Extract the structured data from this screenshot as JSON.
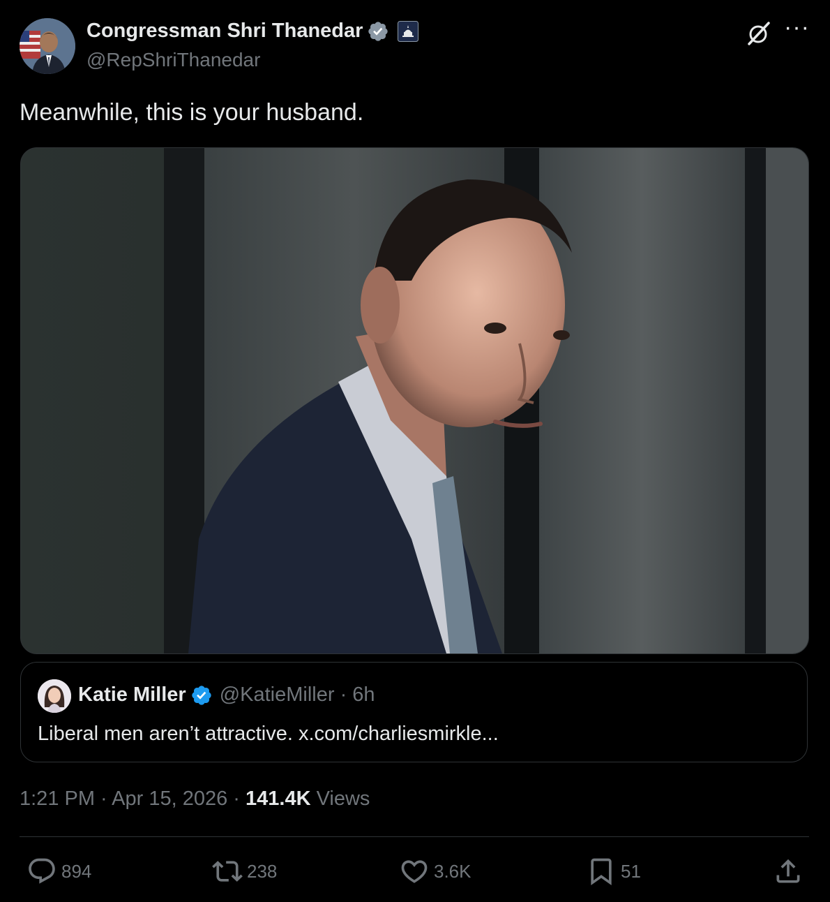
{
  "author": {
    "display_name": "Congressman Shri Thanedar",
    "handle": "@RepShriThanedar",
    "verified_icon": "verified-badge-icon",
    "affiliation_icon": "capitol-badge-icon"
  },
  "tweet": {
    "text": "Meanwhile, this is your husband."
  },
  "quote": {
    "display_name": "Katie Miller",
    "handle_time": "@KatieMiller · 6h",
    "text": "Liberal men aren’t attractive. x.com/charliesmirkle..."
  },
  "meta": {
    "time_date": "1:21 PM · Apr 15, 2026 · ",
    "views_count": "141.4K",
    "views_label": " Views"
  },
  "actions": {
    "replies": "894",
    "reposts": "238",
    "likes": "3.6K",
    "bookmarks": "51"
  },
  "colors": {
    "background": "#000000",
    "text": "#e7e9ea",
    "muted": "#71767b",
    "verified": "#1d9bf0",
    "border": "#2f3336"
  }
}
